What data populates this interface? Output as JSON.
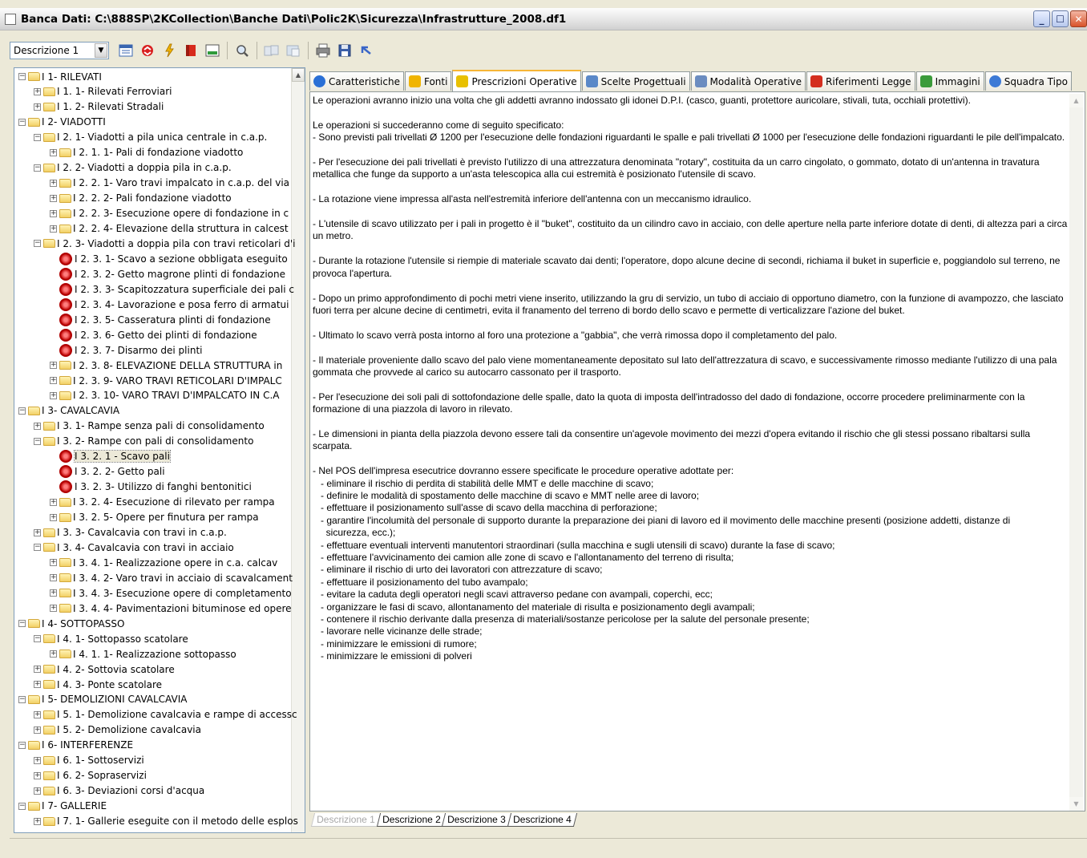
{
  "window": {
    "title": "Banca Dati: C:\\888SP\\2KCollection\\Banche Dati\\Polic2K\\Sicurezza\\Infrastrutture_2008.df1"
  },
  "toolbar": {
    "combo_value": "Descrizione 1"
  },
  "tree": {
    "selected": "I 3.  2.  1 - Scavo pali",
    "rows": [
      {
        "label": "I 1- RILEVATI",
        "level": 0,
        "type": "folder",
        "expanded": true
      },
      {
        "label": "I 1.  1- Rilevati Ferroviari",
        "level": 1,
        "type": "folder",
        "expanded": false
      },
      {
        "label": "I 1.  2- Rilevati Stradali",
        "level": 1,
        "type": "folder",
        "expanded": false
      },
      {
        "label": "I 2- VIADOTTI",
        "level": 0,
        "type": "folder",
        "expanded": true
      },
      {
        "label": "I 2.  1- Viadotti a pila unica centrale in c.a.p.",
        "level": 1,
        "type": "folder",
        "expanded": true
      },
      {
        "label": "I 2.  1.  1- Pali di fondazione viadotto",
        "level": 2,
        "type": "folder",
        "expanded": false
      },
      {
        "label": "I 2.  2- Viadotti a doppia pila in c.a.p.",
        "level": 1,
        "type": "folder",
        "expanded": true
      },
      {
        "label": "I 2.  2.  1- Varo travi impalcato in c.a.p. del via",
        "level": 2,
        "type": "folder",
        "expanded": false
      },
      {
        "label": "I 2.  2.  2- Pali fondazione viadotto",
        "level": 2,
        "type": "folder",
        "expanded": false
      },
      {
        "label": "I 2.  2.  3- Esecuzione opere di fondazione in c",
        "level": 2,
        "type": "folder",
        "expanded": false
      },
      {
        "label": "I 2.  2.  4- Elevazione della struttura in calcest",
        "level": 2,
        "type": "folder",
        "expanded": false
      },
      {
        "label": "I 2.  3- Viadotti a doppia pila con travi reticolari d'i",
        "level": 1,
        "type": "folder",
        "expanded": true
      },
      {
        "label": "I 2.  3.  1- Scavo a sezione obbligata eseguito",
        "level": 2,
        "type": "task"
      },
      {
        "label": "I 2.  3.  2- Getto magrone plinti di fondazione",
        "level": 2,
        "type": "task"
      },
      {
        "label": "I 2.  3.  3- Scapitozzatura superficiale dei pali c",
        "level": 2,
        "type": "task"
      },
      {
        "label": "I 2.  3.  4- Lavorazione e posa ferro di armatui",
        "level": 2,
        "type": "task"
      },
      {
        "label": "I 2.  3.  5- Casseratura plinti di fondazione",
        "level": 2,
        "type": "task"
      },
      {
        "label": "I 2.  3.  6- Getto dei plinti di fondazione",
        "level": 2,
        "type": "task"
      },
      {
        "label": "I 2.  3.  7- Disarmo dei plinti",
        "level": 2,
        "type": "task"
      },
      {
        "label": "I 2.  3.  8- ELEVAZIONE DELLA STRUTTURA in",
        "level": 2,
        "type": "folder",
        "expanded": false
      },
      {
        "label": "I 2.  3.  9- VARO TRAVI RETICOLARI D'IMPALC",
        "level": 2,
        "type": "folder",
        "expanded": false
      },
      {
        "label": "I 2.  3. 10- VARO TRAVI D'IMPALCATO IN C.A",
        "level": 2,
        "type": "folder",
        "expanded": false
      },
      {
        "label": "I 3- CAVALCAVIA",
        "level": 0,
        "type": "folder",
        "expanded": true
      },
      {
        "label": "I 3.  1- Rampe senza pali di consolidamento",
        "level": 1,
        "type": "folder",
        "expanded": false
      },
      {
        "label": "I 3.  2- Rampe con pali di consolidamento",
        "level": 1,
        "type": "folder",
        "expanded": true
      },
      {
        "label": "I 3.  2.  1 - Scavo pali",
        "level": 2,
        "type": "task"
      },
      {
        "label": "I 3.  2.  2- Getto pali",
        "level": 2,
        "type": "task"
      },
      {
        "label": "I 3.  2.  3- Utilizzo di fanghi bentonitici",
        "level": 2,
        "type": "task"
      },
      {
        "label": "I 3.  2.  4- Esecuzione di rilevato per rampa",
        "level": 2,
        "type": "folder",
        "expanded": false
      },
      {
        "label": "I 3.  2.  5- Opere per finutura per rampa",
        "level": 2,
        "type": "folder",
        "expanded": false
      },
      {
        "label": "I 3.  3- Cavalcavia con travi in c.a.p.",
        "level": 1,
        "type": "folder",
        "expanded": false
      },
      {
        "label": "I 3.  4- Cavalcavia con travi in acciaio",
        "level": 1,
        "type": "folder",
        "expanded": true
      },
      {
        "label": "I 3.  4.  1- Realizzazione opere in c.a. calcav",
        "level": 2,
        "type": "folder",
        "expanded": false
      },
      {
        "label": "I 3.  4.  2- Varo travi in acciaio di scavalcament",
        "level": 2,
        "type": "folder",
        "expanded": false
      },
      {
        "label": "I 3.  4.  3- Esecuzione opere di completamento",
        "level": 2,
        "type": "folder",
        "expanded": false
      },
      {
        "label": "I 3.  4.  4- Pavimentazioni bituminose ed opere",
        "level": 2,
        "type": "folder",
        "expanded": false
      },
      {
        "label": "I 4- SOTTOPASSO",
        "level": 0,
        "type": "folder",
        "expanded": true
      },
      {
        "label": "I 4.  1- Sottopasso scatolare",
        "level": 1,
        "type": "folder",
        "expanded": true
      },
      {
        "label": "I 4.  1.  1- Realizzazione sottopasso",
        "level": 2,
        "type": "folder",
        "expanded": false
      },
      {
        "label": "I 4.  2- Sottovia scatolare",
        "level": 1,
        "type": "folder",
        "expanded": false
      },
      {
        "label": "I 4.  3- Ponte scatolare",
        "level": 1,
        "type": "folder",
        "expanded": false
      },
      {
        "label": "I 5- DEMOLIZIONI CAVALCAVIA",
        "level": 0,
        "type": "folder",
        "expanded": true
      },
      {
        "label": "I 5.  1- Demolizione cavalcavia e rampe di accessc",
        "level": 1,
        "type": "folder",
        "expanded": false
      },
      {
        "label": "I 5.  2- Demolizione cavalcavia",
        "level": 1,
        "type": "folder",
        "expanded": false
      },
      {
        "label": "I 6- INTERFERENZE",
        "level": 0,
        "type": "folder",
        "expanded": true
      },
      {
        "label": "I 6.  1- Sottoservizi",
        "level": 1,
        "type": "folder",
        "expanded": false
      },
      {
        "label": "I 6.  2- Sopraservizi",
        "level": 1,
        "type": "folder",
        "expanded": false
      },
      {
        "label": "I 6.  3- Deviazioni corsi d'acqua",
        "level": 1,
        "type": "folder",
        "expanded": false
      },
      {
        "label": "I 7- GALLERIE",
        "level": 0,
        "type": "folder",
        "expanded": true
      },
      {
        "label": "I 7.  1- Gallerie eseguite con il metodo delle esplos",
        "level": 1,
        "type": "folder",
        "expanded": false
      }
    ]
  },
  "tabs": [
    {
      "label": "Caratteristiche",
      "icon": "info-icon",
      "color": "#2a6fd6",
      "active": false
    },
    {
      "label": "Fonti",
      "icon": "lightning-icon",
      "color": "#f0b400",
      "active": false
    },
    {
      "label": "Prescrizioni Operative",
      "icon": "warning-icon",
      "color": "#e8c000",
      "active": true
    },
    {
      "label": "Scelte Progettuali",
      "icon": "design-icon",
      "color": "#5a88c8",
      "active": false
    },
    {
      "label": "Modalità Operative",
      "icon": "window-icon",
      "color": "#6b8cc0",
      "active": false
    },
    {
      "label": "Riferimenti Legge",
      "icon": "book-icon",
      "color": "#d42e1f",
      "active": false
    },
    {
      "label": "Immagini",
      "icon": "image-icon",
      "color": "#3b9b3b",
      "active": false
    },
    {
      "label": "Squadra Tipo",
      "icon": "people-icon",
      "color": "#3d7ad6",
      "active": false
    }
  ],
  "content_text": "Le operazioni avranno inizio una volta che gli addetti avranno indossato gli idonei D.P.I. (casco, guanti, protettore auricolare, stivali, tuta, occhiali protettivi).\n\nLe operazioni si succederanno come di seguito specificato:\n- Sono previsti pali trivellati Ø 1200 per l'esecuzione delle fondazioni riguardanti le spalle e pali trivellati Ø 1000 per l'esecuzione delle fondazioni riguardanti le pile dell'impalcato.\n\n- Per l'esecuzione dei pali trivellati è previsto l'utilizzo di una attrezzatura denominata \"rotary\", costituita da un carro cingolato, o gommato, dotato di un'antenna in travatura metallica che funge da supporto a un'asta telescopica alla cui estremità è posizionato l'utensile di scavo.\n\n- La rotazione viene impressa all'asta nell'estremità inferiore dell'antenna con un meccanismo idraulico.\n\n- L'utensile di scavo utilizzato per i pali in progetto è il \"buket\", costituito da un cilindro cavo in acciaio, con delle aperture nella parte inferiore dotate di denti, di altezza pari a circa un metro.\n\n- Durante la rotazione l'utensile si riempie di materiale scavato dai denti; l'operatore, dopo alcune decine di secondi, richiama il buket in superficie e, poggiandolo sul terreno, ne provoca l'apertura.\n\n- Dopo un primo approfondimento di pochi metri viene inserito, utilizzando la gru di servizio, un tubo di acciaio di opportuno diametro, con la funzione di avampozzo, che lasciato fuori terra per alcune decine di centimetri, evita il franamento del terreno di bordo dello scavo e permette di verticalizzare l'azione del buket.\n\n- Ultimato lo scavo verrà posta intorno al foro una protezione a \"gabbia\", che verrà rimossa dopo il completamento del palo.\n\n- Il materiale proveniente dallo scavo del palo viene momentaneamente depositato sul lato dell'attrezzatura di scavo, e successivamente rimosso mediante l'utilizzo di una pala gommata che provvede al carico su autocarro cassonato per il trasporto.\n\n- Per l'esecuzione dei soli pali di sottofondazione delle spalle, dato la quota di imposta dell'intradosso del dado di fondazione, occorre procedere preliminarmente con la formazione di una piazzola di lavoro in rilevato.\n\n- Le dimensioni in pianta della piazzola devono essere tali da consentire un'agevole movimento dei mezzi d'opera evitando il rischio che gli stessi possano ribaltarsi sulla scarpata.\n\n- Nel POS dell'impresa esecutrice dovranno essere specificate le procedure operative adottate per:\n   - eliminare il rischio di perdita di stabilità delle MMT e delle macchine di scavo;\n   - definire le modalità di spostamento delle macchine di scavo e MMT nelle aree di lavoro;\n   - effettuare il posizionamento sull'asse di scavo della macchina di perforazione;\n   - garantire l'incolumità del personale di supporto durante la preparazione dei piani di lavoro ed il movimento delle macchine presenti (posizione addetti, distanze di\n     sicurezza, ecc.);\n   - effettuare eventuali interventi manutentori straordinari (sulla macchina e sugli utensili di scavo) durante la fase di scavo;\n   - effettuare l'avvicinamento dei camion alle zone di scavo e l'allontanamento del terreno di risulta;\n   - eliminare il rischio di urto dei lavoratori con attrezzature di scavo;\n   - effettuare il posizionamento del tubo avampalo;\n   - evitare la caduta degli operatori negli scavi attraverso pedane con avampali, coperchi, ecc;\n   - organizzare le fasi di scavo, allontanamento del materiale di risulta e posizionamento degli avampali;\n   - contenere il rischio derivante dalla presenza di materiali/sostanze pericolose per la salute del personale presente;\n   - lavorare nelle vicinanze delle strade;\n   - minimizzare le emissioni di rumore;\n   - minimizzare le emissioni di polveri",
  "bottom_tabs": [
    "Descrizione 1",
    "Descrizione 2",
    "Descrizione 3",
    "Descrizione 4"
  ],
  "toolbar_icons": [
    "list-view-icon",
    "refresh-icon",
    "lightning-icon",
    "book-icon",
    "panel-icon",
    "search-icon",
    "copy-icon",
    "paste-icon",
    "print-icon",
    "save-icon",
    "undo-icon"
  ]
}
